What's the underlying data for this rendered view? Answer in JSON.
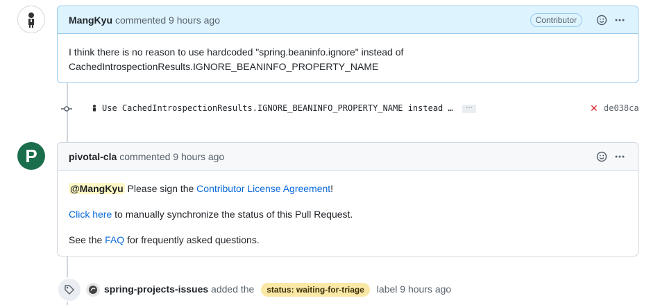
{
  "comment1": {
    "author": "MangKyu",
    "action_text": "commented 9 hours ago",
    "badge": "Contributor",
    "body_line1": "I think there is no reason to use hardcoded \"spring.beaninfo.ignore\" instead of",
    "body_line2": "CachedIntrospectionResults.IGNORE_BEANINFO_PROPERTY_NAME"
  },
  "commit": {
    "message": "Use CachedIntrospectionResults.IGNORE_BEANINFO_PROPERTY_NAME instead …",
    "ellipsis": "…",
    "status": "✕",
    "sha": "de038ca"
  },
  "comment2": {
    "author": "pivotal-cla",
    "action_text": "commented 9 hours ago",
    "avatar_letter": "P",
    "mention": "@MangKyu",
    "p1_text": "Please sign the",
    "p1_link": "Contributor License Agreement",
    "p1_end": "!",
    "p2_link": "Click here",
    "p2_text": "to manually synchronize the status of this Pull Request.",
    "p3_text": "See the",
    "p3_link": "FAQ",
    "p3_end": "for frequently asked questions."
  },
  "event": {
    "actor": "spring-projects-issues",
    "text_before": "added the",
    "label": "status: waiting-for-triage",
    "text_after": "label 9 hours ago"
  },
  "colors": {
    "link": "#0969da",
    "bot_avatar": "#1b6e4c",
    "label_bg": "#fae8a6",
    "header_highlight": "#ddf4ff"
  }
}
